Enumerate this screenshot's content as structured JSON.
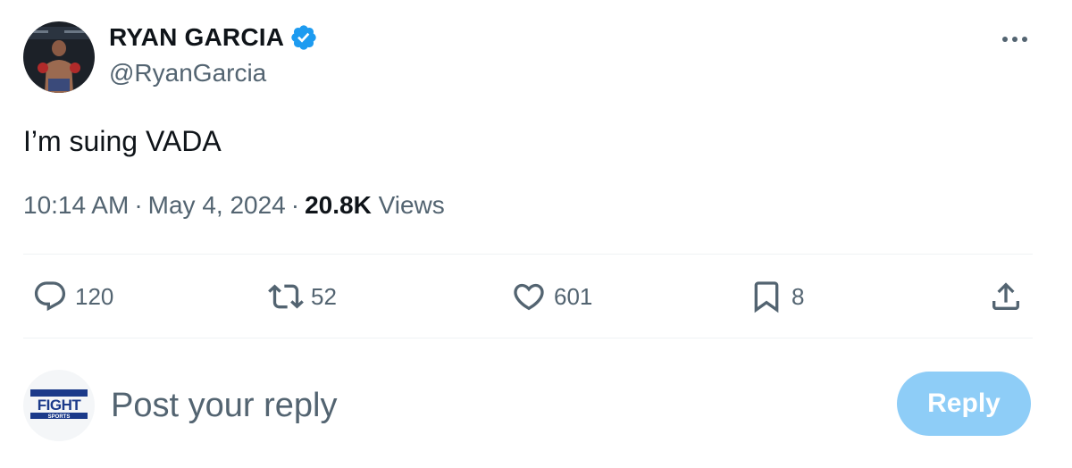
{
  "author": {
    "name": "RYAN GARCIA",
    "handle": "@RyanGarcia",
    "verified": true
  },
  "tweet": {
    "text": "I’m suing VADA",
    "time": "10:14 AM",
    "separator": "·",
    "date": "May 4, 2024",
    "views_count": "20.8K",
    "views_label": "Views"
  },
  "actions": {
    "replies": "120",
    "reposts": "52",
    "likes": "601",
    "bookmarks": "8"
  },
  "reply_box": {
    "placeholder": "Post your reply",
    "button_label": "Reply",
    "avatar_logo": {
      "top": "FIGHT",
      "bottom": "SPORTS"
    }
  },
  "colors": {
    "verified": "#1d9bf0",
    "secondary_text": "#536471",
    "reply_button": "#8ecdf7",
    "divider": "#eff3f4"
  }
}
